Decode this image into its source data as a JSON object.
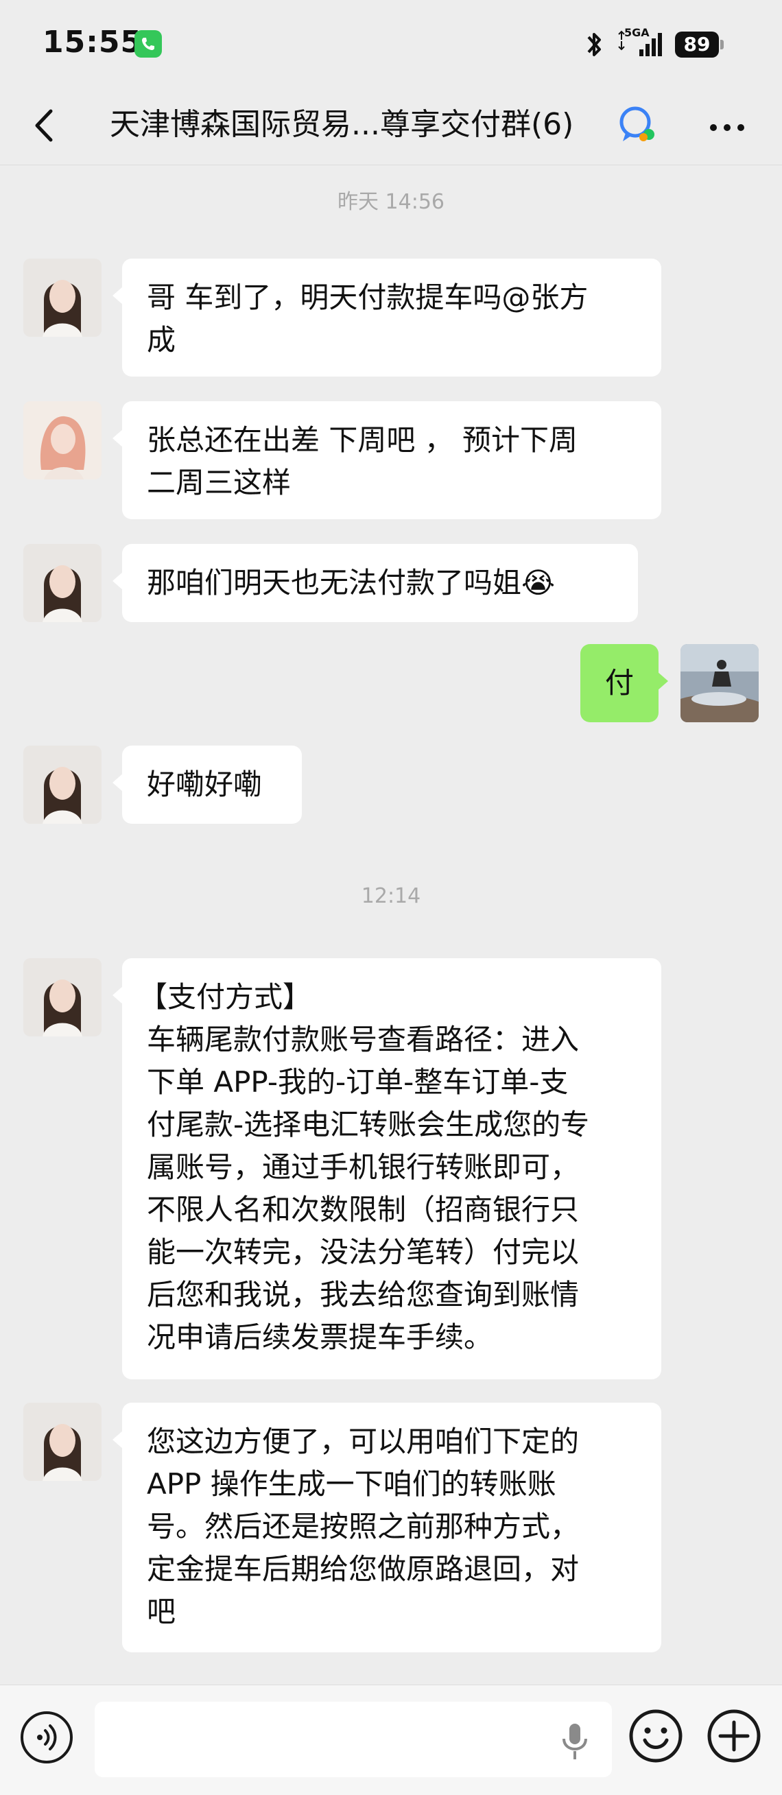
{
  "status_bar": {
    "time": "15:55",
    "network": "5GA",
    "battery": "89"
  },
  "nav": {
    "title": "天津博森国际贸易...尊享交付群(6)"
  },
  "messages": {
    "ts1": "昨天 14:56",
    "m1": {
      "lines": [
        "哥 车到了，明天付款提车吗@张方",
        "成"
      ]
    },
    "m2": {
      "lines": [
        "张总还在出差 下周吧 ， 预计下周",
        "二周三这样"
      ]
    },
    "m3": {
      "text": "那咱们明天也无法付款了吗姐",
      "emoji": "😭"
    },
    "m4": {
      "text": "付"
    },
    "m5": {
      "text": "好嘞好嘞"
    },
    "ts2": "12:14",
    "m6": {
      "lines": [
        "【支付方式】",
        "车辆尾款付款账号查看路径：进入",
        "下单 APP-我的-订单-整车订单-支",
        "付尾款-选择电汇转账会生成您的专",
        "属账号，通过手机银行转账即可，",
        "不限人名和次数限制（招商银行只",
        "能一次转完，没法分笔转）付完以",
        "后您和我说，我去给您查询到账情",
        "况申请后续发票提车手续。"
      ]
    },
    "m7": {
      "lines": [
        "您这边方便了，可以用咱们下定的",
        "APP 操作生成一下咱们的转账账",
        "号。然后还是按照之前那种方式，",
        "定金提车后期给您做原路退回，对",
        "吧"
      ]
    }
  },
  "input": {
    "placeholder": ""
  },
  "colors": {
    "background": "#ededed",
    "my_bubble": "#95ec69",
    "other_bubble": "#ffffff",
    "timestamp": "#a9a9a9"
  },
  "icons": [
    "call-icon",
    "bluetooth-icon",
    "signal-icon",
    "back-icon",
    "group-chat-icon",
    "more-icon",
    "voice-icon",
    "mic-icon",
    "emoji-icon",
    "plus-icon"
  ]
}
